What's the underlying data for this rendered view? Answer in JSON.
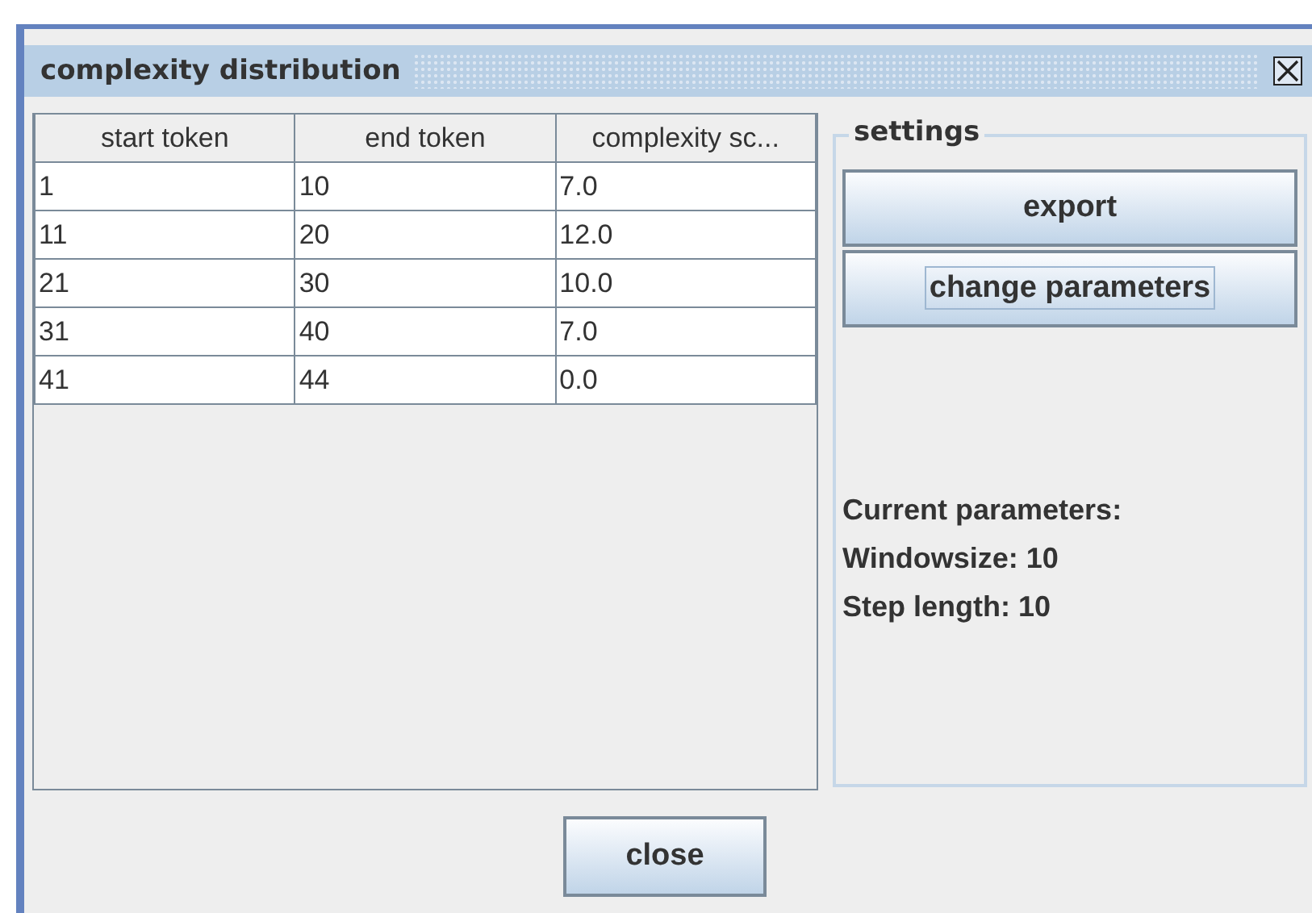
{
  "window": {
    "title": "complexity distribution"
  },
  "table": {
    "columns": [
      "start token",
      "end token",
      "complexity sc..."
    ],
    "rows": [
      [
        "1",
        "10",
        "7.0"
      ],
      [
        "11",
        "20",
        "12.0"
      ],
      [
        "21",
        "30",
        "10.0"
      ],
      [
        "31",
        "40",
        "7.0"
      ],
      [
        "41",
        "44",
        "0.0"
      ]
    ]
  },
  "settings": {
    "title": "settings",
    "buttons": [
      {
        "label": "export",
        "focused": false
      },
      {
        "label": "change parameters",
        "focused": true
      }
    ],
    "info": [
      "Current parameters:",
      "Windowsize: 10",
      "Step length: 10"
    ]
  },
  "footer": {
    "button": "close"
  }
}
